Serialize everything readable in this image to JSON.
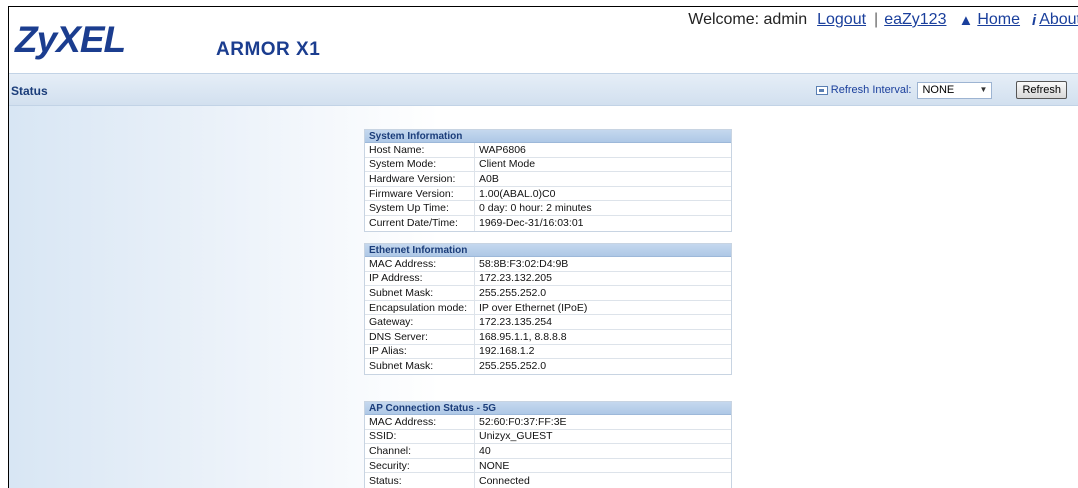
{
  "header": {
    "logo": "ZyXEL",
    "product": "ARMOR X1",
    "welcome": "Welcome: admin",
    "logout": "Logout",
    "separator": "|",
    "eazy": "eaZy123",
    "home": "Home",
    "about": "About"
  },
  "status_bar": {
    "title": "Status",
    "refresh_interval_label": "Refresh Interval:",
    "refresh_interval_value": "NONE",
    "refresh_button": "Refresh"
  },
  "system_info": {
    "title": "System Information",
    "rows": [
      {
        "label": "Host Name:",
        "value": "WAP6806"
      },
      {
        "label": "System Mode:",
        "value": "Client Mode"
      },
      {
        "label": "Hardware Version:",
        "value": "A0B"
      },
      {
        "label": "Firmware Version:",
        "value": "1.00(ABAL.0)C0"
      },
      {
        "label": "System Up Time:",
        "value": "0 day: 0 hour: 2 minutes"
      },
      {
        "label": "Current Date/Time:",
        "value": "1969-Dec-31/16:03:01"
      }
    ]
  },
  "ethernet_info": {
    "title": "Ethernet Information",
    "rows": [
      {
        "label": "MAC Address:",
        "value": "58:8B:F3:02:D4:9B"
      },
      {
        "label": "IP Address:",
        "value": "172.23.132.205"
      },
      {
        "label": "Subnet Mask:",
        "value": "255.255.252.0"
      },
      {
        "label": "Encapsulation mode:",
        "value": "IP over Ethernet (IPoE)"
      },
      {
        "label": "Gateway:",
        "value": "172.23.135.254"
      },
      {
        "label": "DNS Server:",
        "value": "168.95.1.1, 8.8.8.8"
      },
      {
        "label": "IP Alias:",
        "value": "192.168.1.2"
      },
      {
        "label": "Subnet Mask:",
        "value": "255.255.252.0"
      }
    ]
  },
  "ap_status": {
    "title": "AP Connection Status - 5G",
    "rows": [
      {
        "label": "MAC Address:",
        "value": "52:60:F0:37:FF:3E"
      },
      {
        "label": "SSID:",
        "value": "Unizyx_GUEST"
      },
      {
        "label": "Channel:",
        "value": "40"
      },
      {
        "label": "Security:",
        "value": "NONE"
      },
      {
        "label": "Status:",
        "value": "Connected"
      }
    ]
  }
}
